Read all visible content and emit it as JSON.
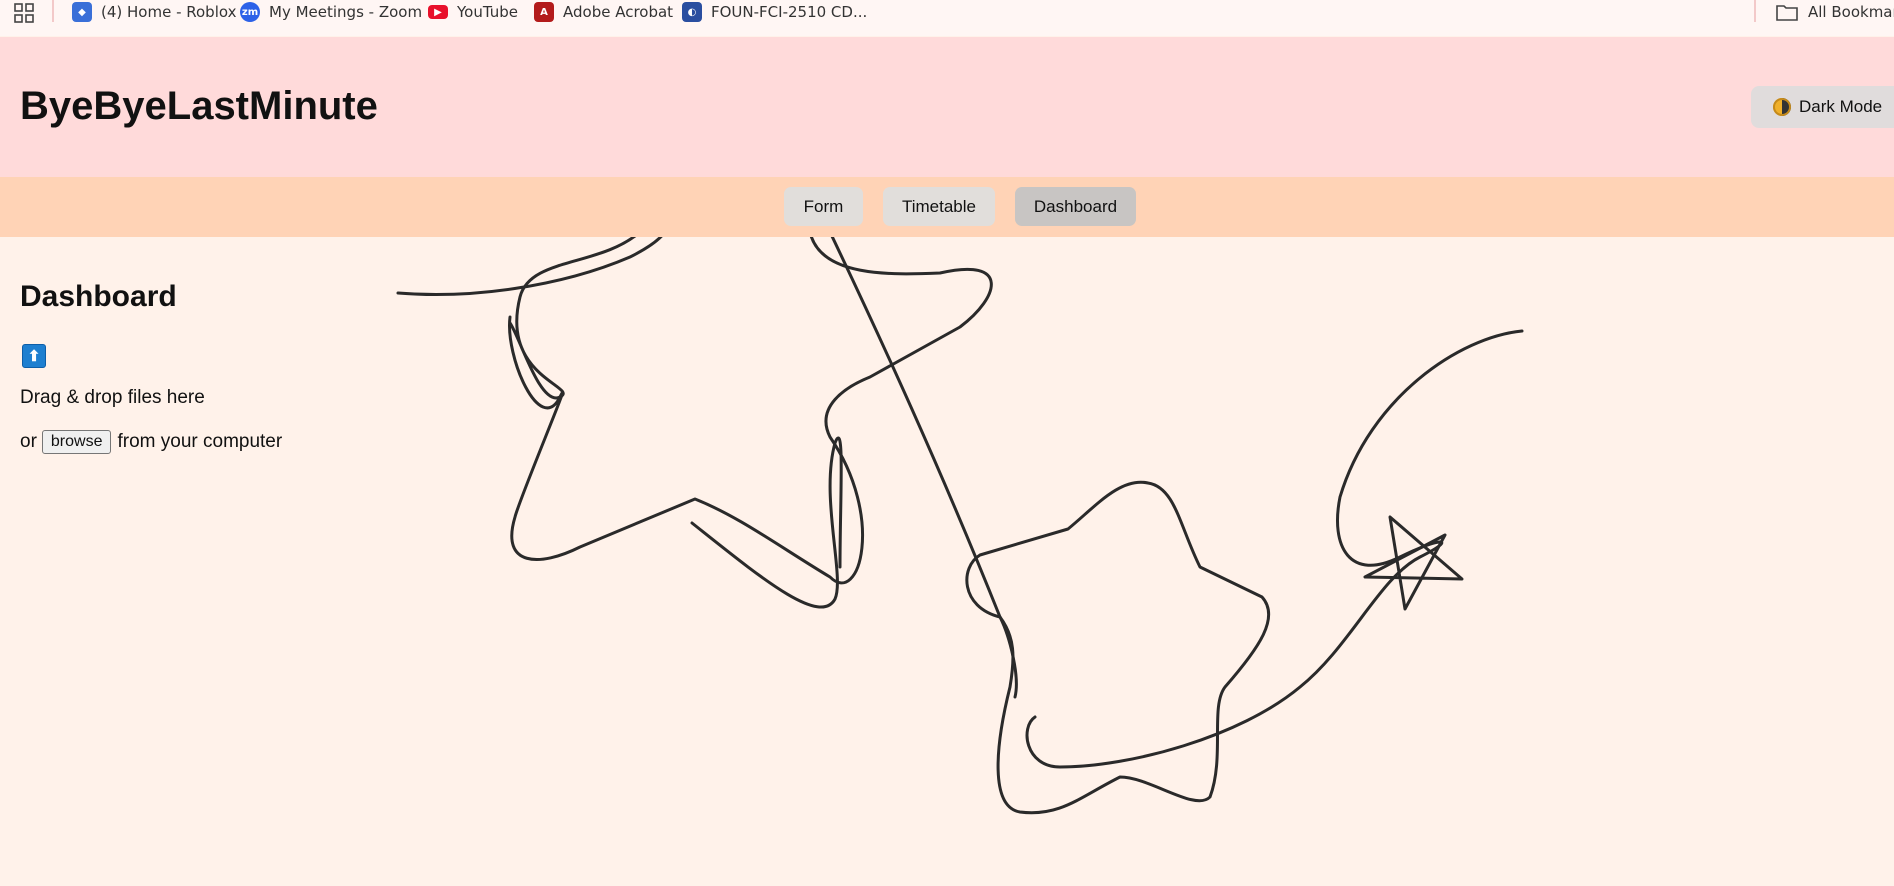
{
  "bookmarks": {
    "items": [
      {
        "label": "(4) Home - Roblox",
        "icon": "roblox-icon",
        "color": "#3a6fd8"
      },
      {
        "label": "My Meetings - Zoom",
        "icon": "zoom-icon",
        "color": "#2d62e8"
      },
      {
        "label": "YouTube",
        "icon": "youtube-icon",
        "color": "#e8102b"
      },
      {
        "label": "Adobe Acrobat",
        "icon": "adobe-acrobat-icon",
        "color": "#b31b1b"
      },
      {
        "label": "FOUN-FCI-2510 CD...",
        "icon": "course-icon",
        "color": "#2a4ea0"
      }
    ],
    "all_bookmarks": "All Bookmarks"
  },
  "header": {
    "title": "ByeByeLastMinute",
    "dark_mode_label": "Dark Mode"
  },
  "nav": {
    "tabs": [
      {
        "label": "Form"
      },
      {
        "label": "Timetable"
      },
      {
        "label": "Dashboard",
        "active": true
      }
    ]
  },
  "main": {
    "heading": "Dashboard",
    "upload_icon": "⬆",
    "drop_text": "Drag & drop files here",
    "browse_prefix": "or",
    "browse_button": "browse",
    "browse_suffix": "from your computer"
  },
  "colors": {
    "header_bg": "#ffdada",
    "nav_bg": "#ffd3b6",
    "page_bg": "#fff2ea",
    "active_tab": "#c8c5c3"
  }
}
